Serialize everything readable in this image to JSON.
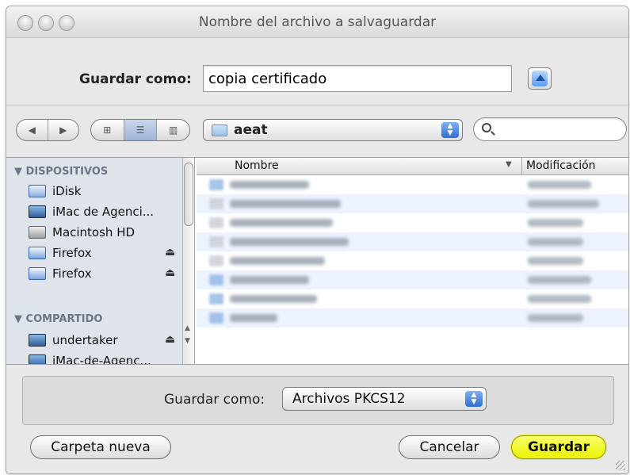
{
  "window": {
    "title": "Nombre del archivo a salvaguardar"
  },
  "save": {
    "label": "Guardar como:",
    "filename": "copia certificado"
  },
  "toolbar": {
    "back_icon": "back-arrow-icon",
    "forward_icon": "forward-arrow-icon",
    "views": [
      "icon-view-icon",
      "list-view-icon",
      "column-view-icon"
    ],
    "active_view": "list-view-icon",
    "location": "aeat",
    "search_placeholder": ""
  },
  "sidebar": {
    "sections": [
      {
        "title": "DISPOSITIVOS",
        "items": [
          {
            "label": "iDisk",
            "icon": "idisk-icon",
            "eject": false
          },
          {
            "label": "iMac de Agenci...",
            "icon": "imac-icon",
            "eject": false
          },
          {
            "label": "Macintosh HD",
            "icon": "hard-drive-icon",
            "eject": false
          },
          {
            "label": "Firefox",
            "icon": "disk-image-icon",
            "eject": true
          },
          {
            "label": "Firefox",
            "icon": "disk-image-icon",
            "eject": true
          }
        ]
      },
      {
        "title": "COMPARTIDO",
        "items": [
          {
            "label": "undertaker",
            "icon": "network-computer-icon",
            "eject": true
          },
          {
            "label": "iMac-de-Agenc...",
            "icon": "network-computer-icon",
            "eject": false
          }
        ]
      }
    ],
    "eject_glyph": "⏏"
  },
  "filelist": {
    "columns": {
      "name": "Nombre",
      "modified": "Modificación",
      "sort_indicator": "▼"
    },
    "rows": [
      {
        "blurred": true,
        "type": "folder"
      },
      {
        "blurred": true,
        "type": "file"
      },
      {
        "blurred": true,
        "type": "file"
      },
      {
        "blurred": true,
        "type": "file"
      },
      {
        "blurred": true,
        "type": "file"
      },
      {
        "blurred": true,
        "type": "folder"
      },
      {
        "blurred": true,
        "type": "folder"
      },
      {
        "blurred": true,
        "type": "folder"
      }
    ]
  },
  "format": {
    "label": "Guardar como:",
    "selected": "Archivos PKCS12"
  },
  "buttons": {
    "new_folder": "Carpeta nueva",
    "cancel": "Cancelar",
    "save": "Guardar"
  },
  "colors": {
    "default_button": "#ecf200",
    "selection_blue": "#2f6dd1",
    "sidebar_bg": "#dfe4ea"
  }
}
